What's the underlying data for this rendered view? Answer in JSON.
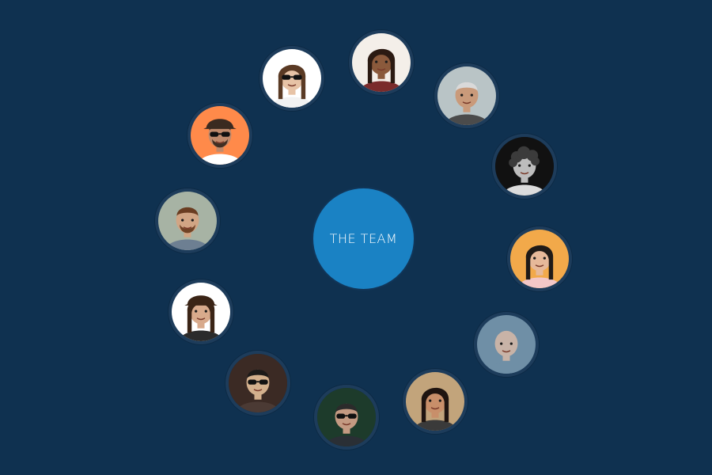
{
  "colors": {
    "background": "#0f3150",
    "ring_border": "#1d3c5b",
    "hub_fill": "#1a82c4",
    "hub_text": "#ffffff"
  },
  "hub": {
    "label": "THE TEAM"
  },
  "members": [
    {
      "id": "m1",
      "bg": "#ffffff",
      "skin": "#e7c3a6",
      "hair": "#5a3a24",
      "shirt": "#f2f2f2",
      "sunglasses": true,
      "beard": false,
      "hat": false,
      "hair_style": "long"
    },
    {
      "id": "m2",
      "bg": "#f4efe9",
      "skin": "#8b5a3c",
      "hair": "#2b1a12",
      "shirt": "#7a2b2b",
      "sunglasses": false,
      "beard": false,
      "hat": false,
      "hair_style": "long"
    },
    {
      "id": "m3",
      "bg": "#b9c4c6",
      "skin": "#c99a7a",
      "hair": "#d9d9d9",
      "shirt": "#4b4b4b",
      "sunglasses": false,
      "beard": false,
      "hat": false,
      "hair_style": "short"
    },
    {
      "id": "m4",
      "bg": "#111111",
      "skin": "#bdbdbd",
      "hair": "#3b3b3b",
      "shirt": "#dcdcdc",
      "sunglasses": false,
      "beard": false,
      "hat": false,
      "hair_style": "curly"
    },
    {
      "id": "m5",
      "bg": "#f2a94a",
      "skin": "#e7b99a",
      "hair": "#1f1a17",
      "shirt": "#f3c7c7",
      "sunglasses": false,
      "beard": false,
      "hat": false,
      "hair_style": "long"
    },
    {
      "id": "m6",
      "bg": "#6f8fa6",
      "skin": "#c8b3a7",
      "hair": "#3a3a3a",
      "shirt": "#6f8fa6",
      "sunglasses": false,
      "beard": false,
      "hat": false,
      "hair_style": "bald"
    },
    {
      "id": "m7",
      "bg": "#c2a47b",
      "skin": "#c88f6a",
      "hair": "#1e1410",
      "shirt": "#3a3a3a",
      "sunglasses": false,
      "beard": false,
      "hat": false,
      "hair_style": "long"
    },
    {
      "id": "m8",
      "bg": "#1d3b2b",
      "skin": "#c49a82",
      "hair": "#2b2b2b",
      "shirt": "#2a2f35",
      "sunglasses": true,
      "beard": false,
      "hat": false,
      "hair_style": "short"
    },
    {
      "id": "m9",
      "bg": "#3b2a24",
      "skin": "#d3b08d",
      "hair": "#1c1a19",
      "shirt": "#4b3a34",
      "sunglasses": true,
      "beard": false,
      "hat": false,
      "hair_style": "short"
    },
    {
      "id": "m10",
      "bg": "#ffffff",
      "skin": "#d8aa8c",
      "hair": "#3a2416",
      "shirt": "#2b2b2b",
      "sunglasses": false,
      "beard": false,
      "hat": true,
      "hair_style": "long"
    },
    {
      "id": "m11",
      "bg": "#a7b3a4",
      "skin": "#d1a584",
      "hair": "#6a3d21",
      "shirt": "#6d7f92",
      "sunglasses": false,
      "beard": true,
      "hat": false,
      "hair_style": "short"
    },
    {
      "id": "m12",
      "bg": "#ff8a4a",
      "skin": "#c08a6c",
      "hair": "#3a2a20",
      "shirt": "#ffffff",
      "sunglasses": true,
      "beard": true,
      "hat": true,
      "hair_style": "short"
    }
  ]
}
